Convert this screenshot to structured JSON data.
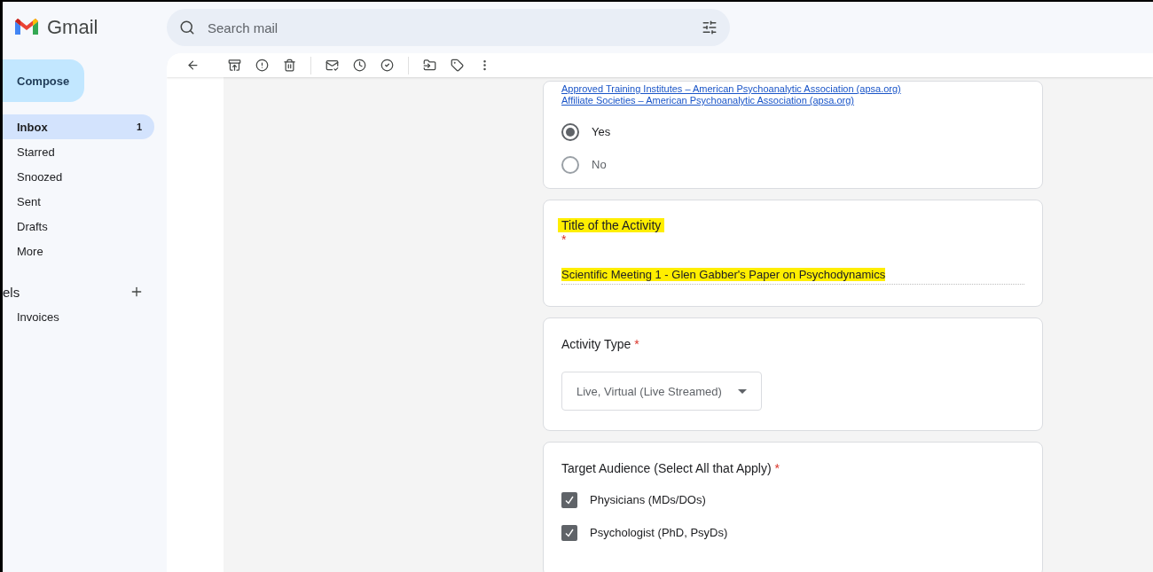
{
  "app": {
    "name": "Gmail"
  },
  "compose": {
    "label": "Compose"
  },
  "search": {
    "placeholder": "Search mail"
  },
  "sidebar": {
    "items": [
      {
        "label": "Inbox",
        "count": "1",
        "selected": true
      },
      {
        "label": "Starred",
        "selected": false
      },
      {
        "label": "Snoozed",
        "selected": false
      },
      {
        "label": "Sent",
        "selected": false
      },
      {
        "label": "Drafts",
        "selected": false
      },
      {
        "label": "More",
        "selected": false
      }
    ],
    "labels_heading": "els",
    "labels": [
      {
        "label": "Invoices"
      }
    ]
  },
  "form": {
    "cards": [
      {
        "kind": "radio",
        "links": [
          "Approved Training Institutes – American Psychoanalytic Association (apsa.org)",
          "Affiliate Societies – American Psychoanalytic Association (apsa.org)"
        ],
        "options": [
          {
            "label": "Yes",
            "selected": true
          },
          {
            "label": "No",
            "selected": false
          }
        ]
      },
      {
        "kind": "text",
        "title": "Title of the Activity",
        "required": "*",
        "title_highlighted": true,
        "value": "Scientific Meeting 1 - Glen Gabber's Paper on Psychodynamics",
        "value_highlighted": true
      },
      {
        "kind": "dropdown",
        "title": "Activity Type",
        "required": "*",
        "value": "Live, Virtual (Live Streamed)"
      },
      {
        "kind": "checkbox",
        "title": "Target Audience (Select All that Apply)",
        "required": "*",
        "options": [
          {
            "label": "Physicians (MDs/DOs)",
            "checked": true
          },
          {
            "label": "Psychologist (PhD, PsyDs)",
            "checked": true
          }
        ]
      }
    ]
  }
}
